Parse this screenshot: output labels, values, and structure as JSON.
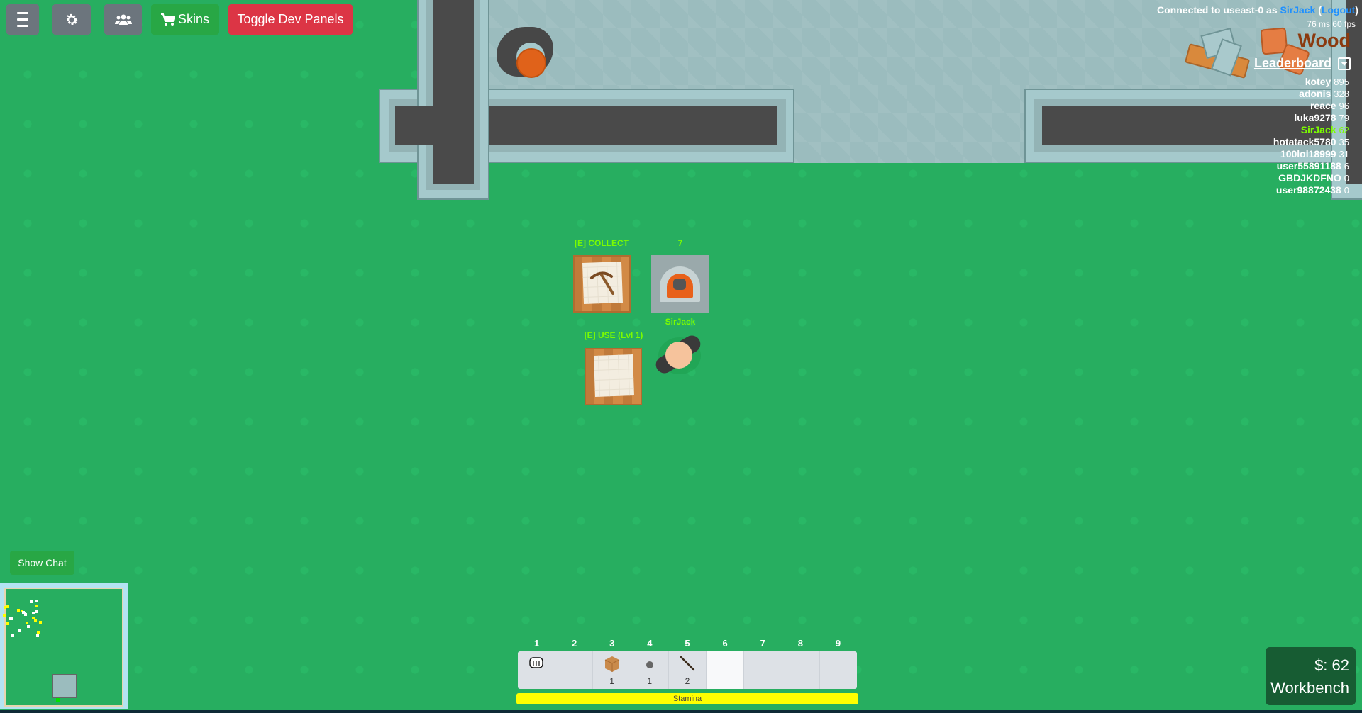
{
  "toolbar": {
    "menu_icon": "hamburger-icon",
    "settings_icon": "gear-icon",
    "friends_icon": "users-icon",
    "skins_label": "Skins",
    "skins_icon": "cart-icon",
    "dev_panels_label": "Toggle Dev Panels"
  },
  "connection": {
    "prefix": "Connected to useast-0 as",
    "username": "SirJack",
    "logout_label": "Logout",
    "latency": "76 ms 60 fps"
  },
  "resource_hint": "Wood",
  "leaderboard": {
    "title": "Leaderboard",
    "entries": [
      {
        "name": "kotey",
        "score": "895"
      },
      {
        "name": "adonis",
        "score": "328"
      },
      {
        "name": "reace",
        "score": "96"
      },
      {
        "name": "luka9278",
        "score": "79"
      },
      {
        "name": "SirJack",
        "score": "62",
        "is_self": true
      },
      {
        "name": "hotatack5780",
        "score": "35"
      },
      {
        "name": "100lol18999",
        "score": "31"
      },
      {
        "name": "user55891188",
        "score": "6"
      },
      {
        "name": "GBDJKDFNO",
        "score": "0"
      },
      {
        "name": "user98872438",
        "score": "0"
      }
    ]
  },
  "world": {
    "collect_bench_label": "[E] COLLECT",
    "furnace_label": "7",
    "player_name": "SirJack",
    "use_bench_label": "[E] USE (Lvl 1)"
  },
  "hotbar": {
    "slots": [
      {
        "number": "1",
        "item": "fist",
        "count": ""
      },
      {
        "number": "2",
        "item": "",
        "count": ""
      },
      {
        "number": "3",
        "item": "wood-block",
        "count": "1"
      },
      {
        "number": "4",
        "item": "stone",
        "count": "1"
      },
      {
        "number": "5",
        "item": "stick",
        "count": "2"
      },
      {
        "number": "6",
        "item": "",
        "count": "",
        "selected": true
      },
      {
        "number": "7",
        "item": "",
        "count": ""
      },
      {
        "number": "8",
        "item": "",
        "count": ""
      },
      {
        "number": "9",
        "item": "",
        "count": ""
      }
    ],
    "stamina_label": "Stamina",
    "stamina_fraction": 1.0
  },
  "status_panel": {
    "money": "$: 62",
    "selected_structure": "Workbench"
  },
  "chat": {
    "show_chat_label": "Show Chat"
  },
  "colors": {
    "grass": "#27ae60",
    "self_highlight": "#7cfc00",
    "link": "#1e90ff",
    "stamina": "#ffff00",
    "danger_button": "#dc3545",
    "success_button": "#28a745"
  }
}
